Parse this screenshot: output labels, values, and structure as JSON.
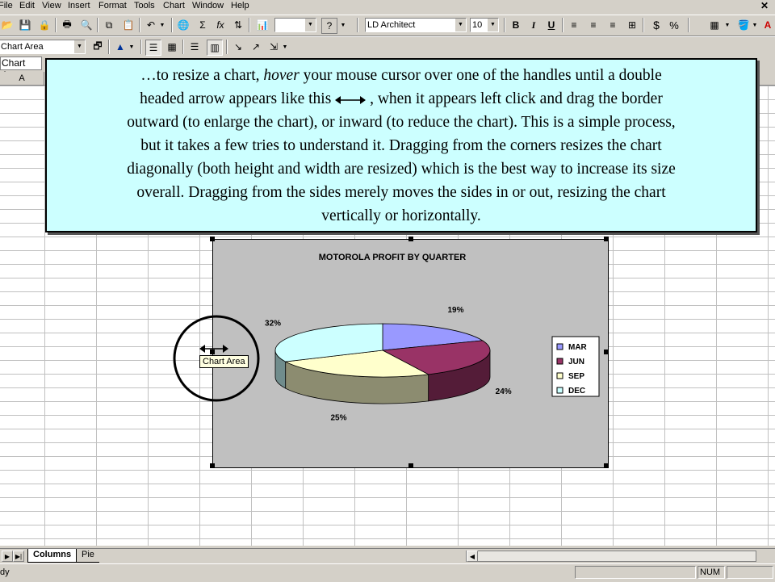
{
  "menu": [
    "File",
    "Edit",
    "View",
    "Insert",
    "Format",
    "Tools",
    "Chart",
    "Window",
    "Help"
  ],
  "toolbar1": {
    "font_name": "LD Architect",
    "font_size": "10",
    "zoom": "",
    "bold": "B",
    "italic": "I",
    "underline": "U",
    "currency": "$",
    "percent": "%"
  },
  "toolbar2": {
    "chart_object": "Chart Area"
  },
  "name_box": "Chart Area",
  "column_header": "A",
  "callout": {
    "line1_a": "…to resize a chart,",
    "line1_em": "hover",
    "line1_b": "your mouse cursor over one of the handles until a double",
    "line2_a": "headed arrow appears like this",
    "line2_b": ", when it appears left click and drag the border",
    "line3": "outward (to enlarge the chart), or inward (to reduce the chart).  This is a simple process,",
    "line4": "but it takes a few tries to understand it.  Dragging from the corners resizes the chart",
    "line5": "diagonally (both height and width are resized) which is the best way to increase its size",
    "line6": "overall.  Dragging from the sides merely moves the sides in or out, resizing the chart",
    "line7": "vertically or horizontally."
  },
  "tooltip": "Chart Area",
  "chart_data": {
    "type": "pie",
    "title": "MOTOROLA PROFIT BY QUARTER",
    "categories": [
      "MAR",
      "JUN",
      "SEP",
      "DEC"
    ],
    "values": [
      19,
      24,
      25,
      32
    ],
    "labels": [
      "19%",
      "24%",
      "25%",
      "32%"
    ],
    "colors": [
      "#9999ff",
      "#993366",
      "#ffffcc",
      "#ccffff"
    ],
    "legend": "right",
    "three_d": true
  },
  "sheet_tabs": [
    "Columns",
    "Pie"
  ],
  "active_tab": "Columns",
  "status": {
    "ready": "dy",
    "num": "NUM"
  }
}
